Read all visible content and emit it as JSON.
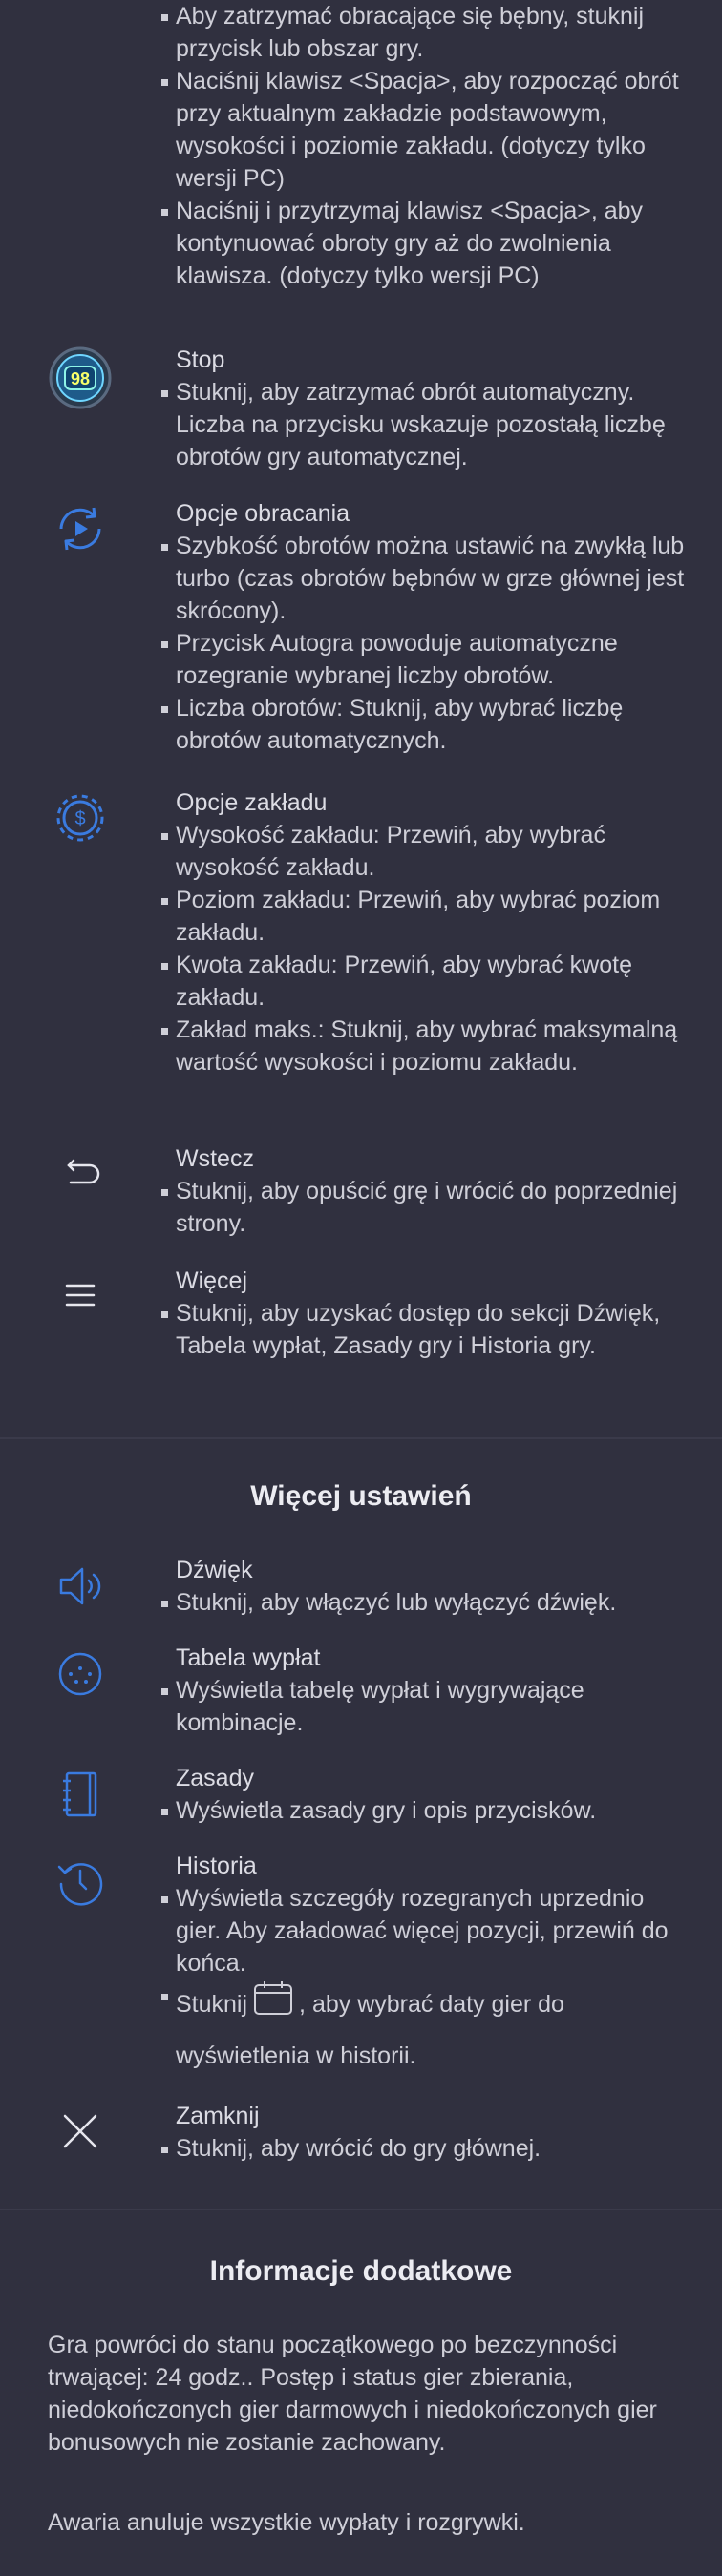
{
  "top_list": {
    "items": [
      "Aby zatrzymać obracające się bębny, stuknij przycisk lub obszar gry.",
      "Naciśnij klawisz <Spacja>, aby rozpocząć obrót przy aktualnym zakładzie podstawowym, wysokości i poziomie zakładu. (dotyczy tylko wersji PC)",
      "Naciśnij i przytrzymaj klawisz <Spacja>, aby kontynuować obroty gry aż do zwolnienia klawisza. (dotyczy tylko wersji PC)"
    ]
  },
  "stop": {
    "badge": "98",
    "title": "Stop",
    "items": [
      "Stuknij, aby zatrzymać obrót automatyczny. Liczba na przycisku wskazuje pozostałą liczbę obrotów gry automatycznej."
    ]
  },
  "spin_options": {
    "title": "Opcje obracania",
    "items": [
      "Szybkość obrotów można ustawić na zwykłą lub turbo (czas obrotów bębnów w grze głównej jest skrócony).",
      "Przycisk Autogra powoduje automatyczne rozegranie wybranej liczby obrotów.",
      "Liczba obrotów: Stuknij, aby wybrać liczbę obrotów automatycznych."
    ]
  },
  "bet_options": {
    "title": "Opcje zakładu",
    "items": [
      "Wysokość zakładu: Przewiń, aby wybrać wysokość zakładu.",
      "Poziom zakładu: Przewiń, aby wybrać poziom zakładu.",
      "Kwota zakładu: Przewiń, aby wybrać kwotę zakładu.",
      "Zakład maks.: Stuknij, aby wybrać maksymalną wartość wysokości i poziomu zakładu."
    ]
  },
  "back": {
    "title": "Wstecz",
    "items": [
      "Stuknij, aby opuścić grę i wrócić do poprzedniej strony."
    ]
  },
  "more": {
    "title": "Więcej",
    "items": [
      "Stuknij, aby uzyskać dostęp do sekcji Dźwięk, Tabela wypłat, Zasady gry i Historia gry."
    ]
  },
  "more_settings": {
    "heading": "Więcej ustawień",
    "sound": {
      "title": "Dźwięk",
      "items": [
        "Stuknij, aby włączyć lub wyłączyć dźwięk."
      ]
    },
    "paytable": {
      "title": "Tabela wypłat",
      "items": [
        "Wyświetla tabelę wypłat i wygrywające kombinacje."
      ]
    },
    "rules": {
      "title": "Zasady",
      "items": [
        "Wyświetla zasady gry i opis przycisków."
      ]
    },
    "history": {
      "title": "Historia",
      "items": [
        "Wyświetla szczegóły rozegranych uprzednio gier. Aby załadować więcej pozycji, przewiń do końca."
      ],
      "calendar_before": "Stuknij",
      "calendar_after": ", aby wybrać daty gier do wyświetlenia w historii."
    },
    "close": {
      "title": "Zamknij",
      "items": [
        "Stuknij, aby wrócić do gry głównej."
      ]
    }
  },
  "additional_info": {
    "heading": "Informacje dodatkowe",
    "paragraphs": [
      "Gra powróci do stanu początkowego po bezczynności trwającej: 24 godz.. Postęp i status gier zbierania, niedokończonych gier darmowych i niedokończonych gier bonusowych nie zostanie zachowany.",
      "Awaria anuluje wszystkie wypłaty i rozgrywki."
    ]
  },
  "colors": {
    "background": "#30303f",
    "icon_blue": "#3a7be0",
    "stop_badge": "#3fe0d0"
  }
}
